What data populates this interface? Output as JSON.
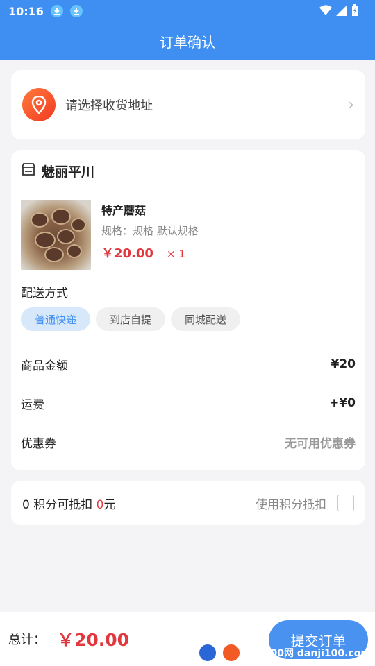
{
  "status": {
    "time": "10:16"
  },
  "header": {
    "title": "订单确认"
  },
  "address": {
    "placeholder": "请选择收货地址"
  },
  "shop": {
    "name": "魅丽平川"
  },
  "product": {
    "name": "特产蘑菇",
    "spec": "规格：规格 默认规格",
    "price": "￥20.00",
    "qty": "× 1"
  },
  "delivery": {
    "label": "配送方式",
    "options": [
      "普通快递",
      "到店自提",
      "同城配送"
    ],
    "selected": "普通快递"
  },
  "summary": {
    "amount_label": "商品金额",
    "amount": "¥20",
    "shipping_label": "运费",
    "shipping": "+¥0",
    "coupon_label": "优惠券",
    "coupon": "无可用优惠券"
  },
  "points": {
    "prefix": "0 积分可抵扣 ",
    "value": "0",
    "suffix": "元",
    "use_label": "使用积分抵扣"
  },
  "footer": {
    "total_label": "总计：",
    "total": "￥20.00",
    "submit": "提交订单"
  },
  "watermark": {
    "text": "单机100网 danji100.com"
  },
  "colors": {
    "primary": "#3f8ff2",
    "price": "#e0383e"
  }
}
